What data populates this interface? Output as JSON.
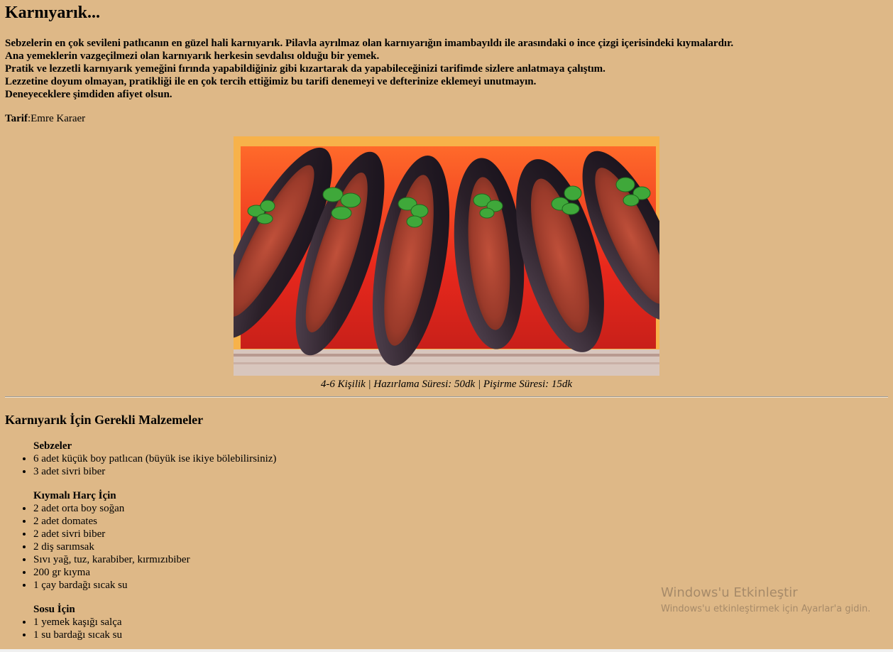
{
  "title": "Karnıyarık...",
  "intro": [
    "Sebzelerin en çok sevileni patlıcanın en güzel hali karnıyarık. Pilavla ayrılmaz olan karnıyarığın imambayıldı ile arasındaki o ince çizgi içerisindeki kıymalardır.",
    "Ana yemeklerin vazgeçilmezi olan karnıyarık herkesin sevdalısı olduğu bir yemek.",
    "Pratik ve lezzetli karnıyarık yemeğini fırında yapabildiğiniz gibi kızartarak da yapabileceğinizi tarifimde sizlere anlatmaya çalıştım.",
    "Lezzetine doyum olmayan, pratikliği ile en çok tercih ettiğimiz bu tarifi denemeyi ve defterinize eklemeyi unutmayın.",
    "Deneyeceklere şimdiden afiyet olsun."
  ],
  "author": {
    "label": "Tarif",
    "sep": ":",
    "name": "Emre Karaer"
  },
  "image_caption": "4-6 Kişilik | Hazırlama Süresi: 50dk | Pişirme Süresi: 15dk",
  "ingredients_heading": "Karnıyarık İçin Gerekli Malzemeler",
  "sections": [
    {
      "title": "Sebzeler",
      "items": [
        "6 adet küçük boy patlıcan (büyük ise ikiye bölebilirsiniz)",
        "3 adet sivri biber"
      ]
    },
    {
      "title": "Kıymalı Harç İçin",
      "items": [
        "2 adet orta boy soğan",
        "2 adet domates",
        "2 adet sivri biber",
        "2 diş sarımsak",
        "Sıvı yağ, tuz, karabiber, kırmızıbiber",
        "200 gr kıyma",
        "1 çay bardağı sıcak su"
      ]
    },
    {
      "title": "Sosu İçin",
      "items": [
        "1 yemek kaşığı salça",
        "1 su bardağı sıcak su"
      ]
    }
  ],
  "watermark": {
    "line1": "Windows'u Etkinleştir",
    "line2": "Windows'u etkinleştirmek için Ayarlar'a gidin."
  },
  "colors": {
    "background": "#deb887"
  }
}
